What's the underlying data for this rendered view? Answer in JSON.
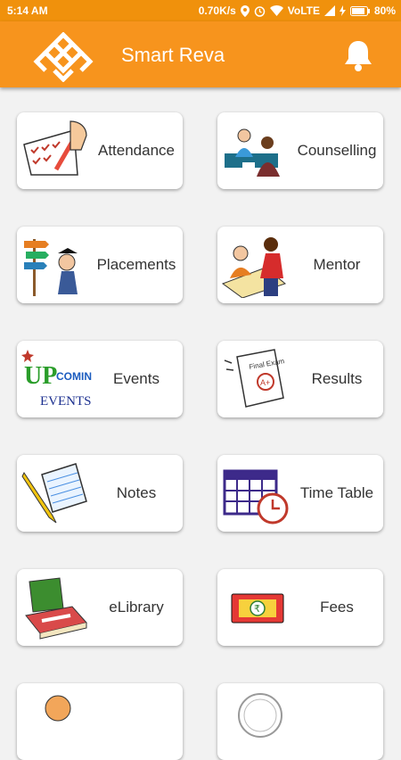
{
  "status_bar": {
    "time": "5:14 AM",
    "speed": "0.70K/s",
    "network": "VoLTE",
    "battery": "80%"
  },
  "app_bar": {
    "title": "Smart Reva",
    "logo_icon": "reva-knot-logo-icon",
    "bell_icon": "bell-icon"
  },
  "colors": {
    "accent": "#f7941d",
    "status_bar": "#f0910c",
    "card": "#ffffff",
    "background": "#f2f2f2"
  },
  "menu": [
    {
      "label": "Attendance",
      "icon": "attendance-checklist-icon"
    },
    {
      "label": "Counselling",
      "icon": "counselling-icon"
    },
    {
      "label": "Placements",
      "icon": "placements-signpost-icon"
    },
    {
      "label": "Mentor",
      "icon": "mentor-icon"
    },
    {
      "label": "Events",
      "icon": "upcoming-events-icon"
    },
    {
      "label": "Results",
      "icon": "results-exam-icon"
    },
    {
      "label": "Notes",
      "icon": "notes-notepad-icon"
    },
    {
      "label": "Time Table",
      "icon": "calendar-clock-icon"
    },
    {
      "label": "eLibrary",
      "icon": "books-icon"
    },
    {
      "label": "Fees",
      "icon": "rupee-note-icon"
    }
  ]
}
